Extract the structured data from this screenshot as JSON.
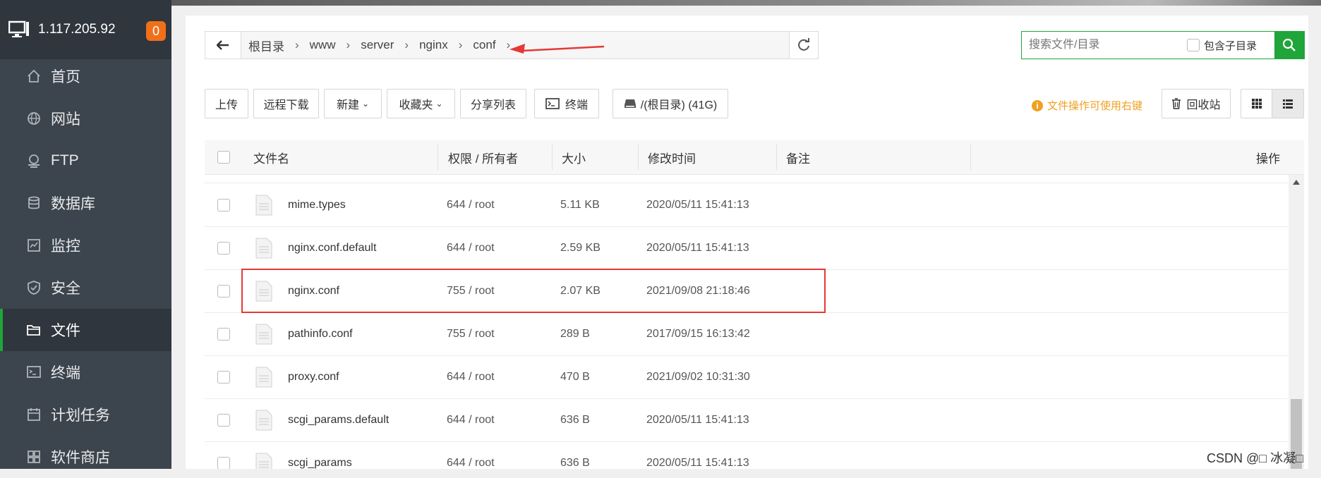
{
  "sidebar": {
    "server_ip": "1.117.205.92",
    "badge_count": "0",
    "items": [
      {
        "label": "首页",
        "icon": "home-icon"
      },
      {
        "label": "网站",
        "icon": "globe-icon"
      },
      {
        "label": "FTP",
        "icon": "ftp-icon"
      },
      {
        "label": "数据库",
        "icon": "database-icon"
      },
      {
        "label": "监控",
        "icon": "monitor-icon"
      },
      {
        "label": "安全",
        "icon": "shield-icon"
      },
      {
        "label": "文件",
        "icon": "folder-icon",
        "active": true
      },
      {
        "label": "终端",
        "icon": "terminal-icon"
      },
      {
        "label": "计划任务",
        "icon": "calendar-icon"
      },
      {
        "label": "软件商店",
        "icon": "apps-icon"
      }
    ]
  },
  "path": {
    "crumbs": [
      "根目录",
      "www",
      "server",
      "nginx",
      "conf"
    ]
  },
  "search": {
    "placeholder": "搜索文件/目录",
    "include_sub": "包含子目录"
  },
  "toolbar": {
    "upload": "上传",
    "remote_download": "远程下载",
    "new": "新建",
    "favorites": "收藏夹",
    "share_list": "分享列表",
    "terminal": "终端",
    "disk": "/(根目录) (41G)",
    "hint": "文件操作可使用右键",
    "recycle": "回收站"
  },
  "table": {
    "headers": {
      "name": "文件名",
      "perm": "权限 / 所有者",
      "size": "大小",
      "mtime": "修改时间",
      "note": "备注",
      "ops": "操作"
    },
    "rows": [
      {
        "name": "mime.types",
        "perm": "644 / root",
        "size": "5.11 KB",
        "mtime": "2020/05/11 15:41:13"
      },
      {
        "name": "nginx.conf.default",
        "perm": "644 / root",
        "size": "2.59 KB",
        "mtime": "2020/05/11 15:41:13"
      },
      {
        "name": "nginx.conf",
        "perm": "755 / root",
        "size": "2.07 KB",
        "mtime": "2021/09/08 21:18:46",
        "highlighted": true
      },
      {
        "name": "pathinfo.conf",
        "perm": "755 / root",
        "size": "289 B",
        "mtime": "2017/09/15 16:13:42"
      },
      {
        "name": "proxy.conf",
        "perm": "644 / root",
        "size": "470 B",
        "mtime": "2021/09/02 10:31:30"
      },
      {
        "name": "scgi_params.default",
        "perm": "644 / root",
        "size": "636 B",
        "mtime": "2020/05/11 15:41:13"
      },
      {
        "name": "scgi_params",
        "perm": "644 / root",
        "size": "636 B",
        "mtime": "2020/05/11 15:41:13"
      }
    ]
  },
  "watermark": "CSDN @□ 冰凝□",
  "colors": {
    "accent": "#20a53a",
    "sidebar_bg": "#3c444d",
    "badge": "#f0701a",
    "hint": "#f0a020",
    "annotation": "#e53935"
  }
}
